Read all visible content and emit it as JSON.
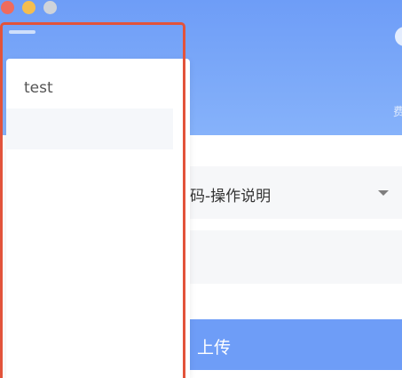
{
  "window": {
    "buttons": [
      "close",
      "minimize",
      "zoom"
    ]
  },
  "header": {
    "edge_text": "费"
  },
  "form": {
    "select_value": "码-操作说明",
    "select_arrow_icon": "caret-down-icon",
    "input_value": "",
    "upload_label": "上传"
  },
  "dropdown": {
    "items": [
      {
        "label": "test"
      },
      {
        "label": ""
      }
    ]
  },
  "colors": {
    "header_top": "#6e9df7",
    "header_bottom": "#86b2fa",
    "accent": "#6e9df7",
    "highlight_border": "#e2533b",
    "field_bg": "#f6f7f9"
  }
}
